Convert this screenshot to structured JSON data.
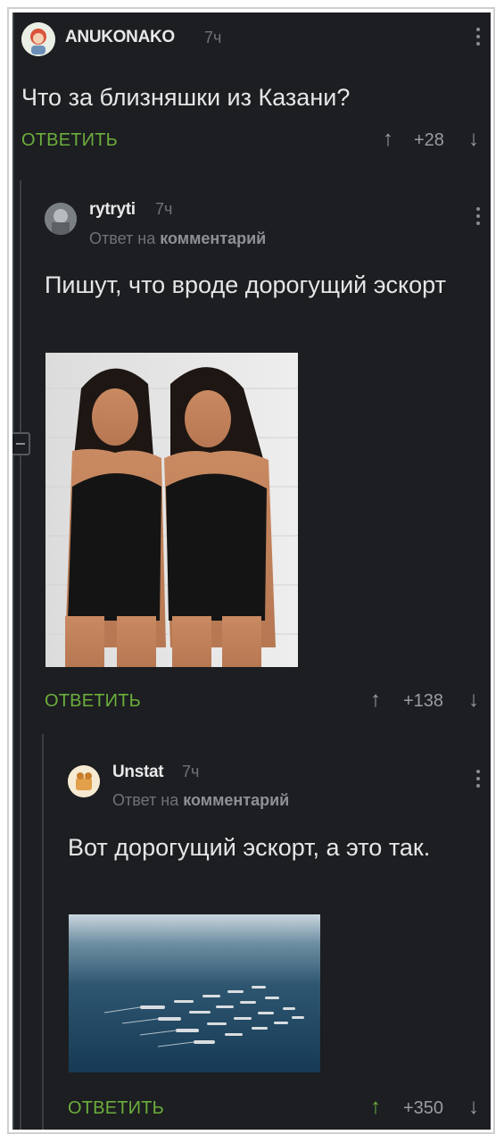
{
  "comments": [
    {
      "author": "ANUKONAKO",
      "time": "7ч",
      "text": "Что за близняшки из Казани?",
      "reply_label": "ОТВЕТИТЬ",
      "score": "+28"
    },
    {
      "author": "rytryti",
      "time": "7ч",
      "reply_prefix": "Ответ на",
      "reply_target": "комментарий",
      "text": "Пишут, что вроде дорогущий эскорт",
      "reply_label": "ОТВЕТИТЬ",
      "score": "+138"
    },
    {
      "author": "Unstat",
      "time": "7ч",
      "reply_prefix": "Ответ на",
      "reply_target": "комментарий",
      "text": "Вот дорогущий эскорт, а это так.",
      "reply_label": "ОТВЕТИТЬ",
      "score": "+350"
    }
  ],
  "icons": {
    "upvote": "arrow-up-icon",
    "downvote": "arrow-down-icon",
    "menu": "more-vertical-icon",
    "collapse": "collapse-minus-icon"
  },
  "colors": {
    "background": "#1c1e21",
    "accent_green": "#6cae3c",
    "text": "#e6e6e6",
    "muted": "#6f7377"
  }
}
